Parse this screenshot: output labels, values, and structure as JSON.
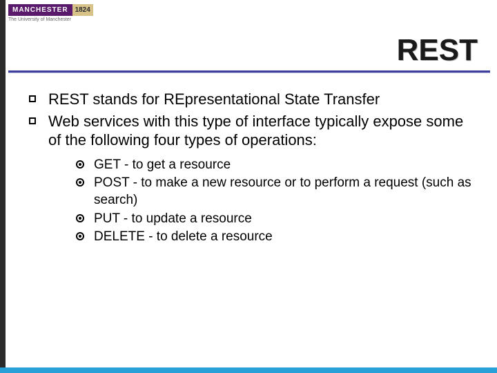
{
  "logo": {
    "name": "MANCHESTER",
    "year": "1824",
    "subtitle": "The University of Manchester"
  },
  "title": "REST",
  "bullets": [
    {
      "text": "REST stands for  REpresentational State Transfer"
    },
    {
      "text": "Web services with this type of interface typically expose some of the following four types of operations:"
    }
  ],
  "sub_bullets": [
    {
      "text": "GET - to get a resource"
    },
    {
      "text": "POST - to make a new resource or to perform a request (such as search)"
    },
    {
      "text": "PUT - to update a resource"
    },
    {
      "text": "DELETE - to delete a resource"
    }
  ]
}
